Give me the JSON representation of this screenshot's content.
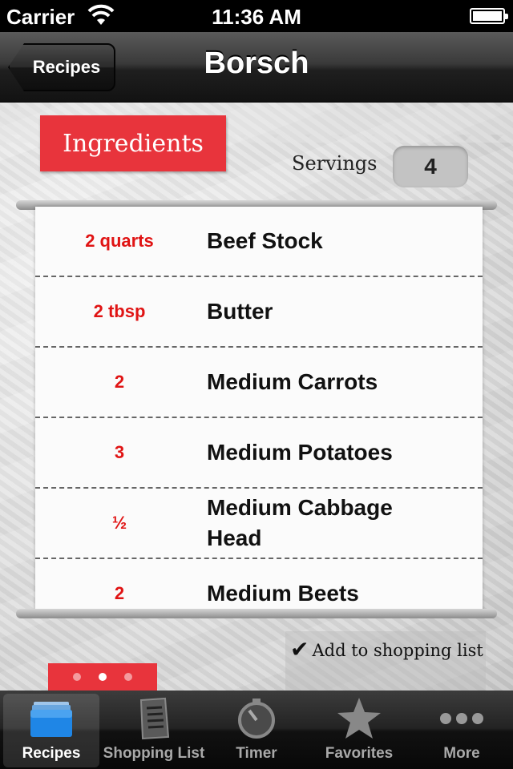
{
  "status_bar": {
    "carrier": "Carrier",
    "time": "11:36 AM"
  },
  "nav": {
    "back_label": "Recipes",
    "title": "Borsch"
  },
  "section": {
    "title": "Ingredients",
    "servings_label": "Servings",
    "servings_value": "4"
  },
  "ingredients": [
    {
      "qty": "2 quarts",
      "name": "Beef Stock"
    },
    {
      "qty": "2 tbsp",
      "name": "Butter"
    },
    {
      "qty": "2",
      "name": "Medium Carrots"
    },
    {
      "qty": "3",
      "name": "Medium Potatoes"
    },
    {
      "qty": "½",
      "name": "Medium Cabbage Head"
    },
    {
      "qty": "2",
      "name": "Medium Beets"
    }
  ],
  "add_to_list_label": "Add to shopping list",
  "pager": {
    "pages": 3,
    "current": 2
  },
  "tabs": [
    {
      "label": "Recipes",
      "icon": "recipes-icon",
      "active": true
    },
    {
      "label": "Shopping List",
      "icon": "shopping-list-icon",
      "active": false
    },
    {
      "label": "Timer",
      "icon": "timer-icon",
      "active": false
    },
    {
      "label": "Favorites",
      "icon": "star-icon",
      "active": false
    },
    {
      "label": "More",
      "icon": "more-icon",
      "active": false
    }
  ],
  "colors": {
    "accent_red": "#e8343c",
    "quantity_red": "#e01414"
  }
}
